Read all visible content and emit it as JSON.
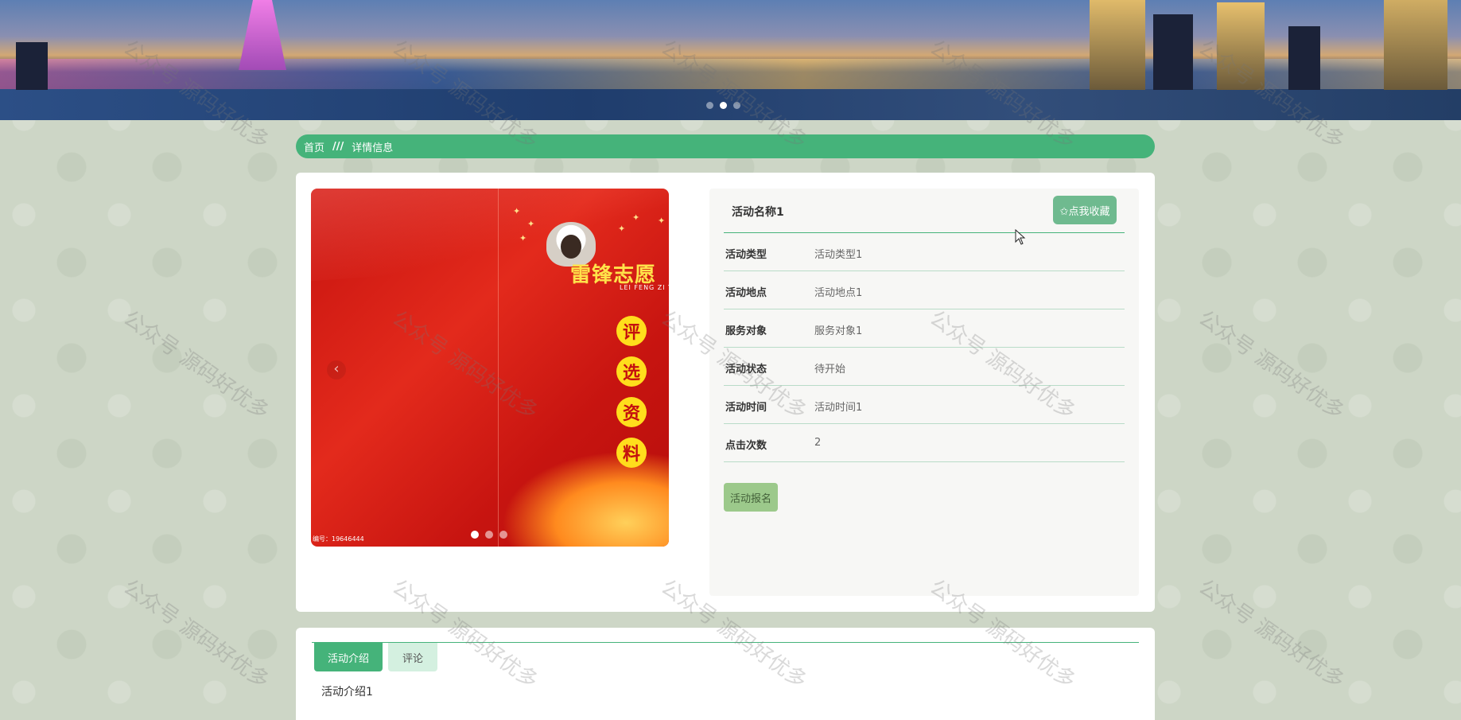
{
  "banner": {
    "slides": 3,
    "active_slide": 2
  },
  "breadcrumb": {
    "home": "首页",
    "separator": "///",
    "current": "详情信息"
  },
  "gallery": {
    "poster_title": "雷锋志愿",
    "poster_subtitle": "LEI FENG ZI YU",
    "poster_badges": [
      "评",
      "选",
      "资",
      "料"
    ],
    "serial_label": "编号：19646444",
    "prev_icon": "‹",
    "slides": 3,
    "active_slide": 1
  },
  "detail": {
    "title": "活动名称1",
    "favorite_label": "✩点我收藏",
    "fields": [
      {
        "label": "活动类型",
        "value": "活动类型1"
      },
      {
        "label": "活动地点",
        "value": "活动地点1"
      },
      {
        "label": "服务对象",
        "value": "服务对象1"
      },
      {
        "label": "活动状态",
        "value": "待开始"
      },
      {
        "label": "活动时间",
        "value": "活动时间1"
      },
      {
        "label": "点击次数",
        "value": "2"
      }
    ],
    "signup_label": "活动报名"
  },
  "tabs": {
    "items": [
      {
        "label": "活动介绍",
        "active": true
      },
      {
        "label": "评论",
        "active": false
      }
    ],
    "content": "活动介绍1"
  },
  "watermark": "公众号 源码好优多",
  "colors": {
    "accent": "#45b37a",
    "favorite_button": "#6fba8f",
    "signup_button": "#9cc98b",
    "page_background": "#cdd6c6"
  }
}
